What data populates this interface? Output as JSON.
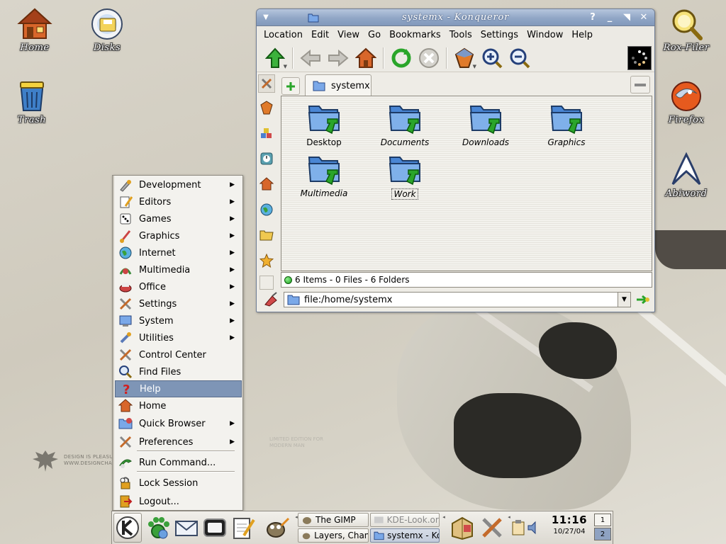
{
  "desktop": {
    "icons": [
      {
        "label": "Home"
      },
      {
        "label": "Disks"
      },
      {
        "label": "Trash"
      },
      {
        "label": "Rox-Filer"
      },
      {
        "label": "Firefox"
      },
      {
        "label": "Abiword"
      }
    ],
    "watermark": {
      "line1": "DESIGN IS PLEASURE",
      "line2": "WWW.DESIGNCHAPE..."
    },
    "watermark2": {
      "line1": "LIMITED EDITION FOR",
      "line2": "MODERN MAN"
    }
  },
  "konqueror": {
    "title": "systemx - Konqueror",
    "title_buttons": {
      "help": "?",
      "minimize": "_",
      "shade": "◥",
      "close": "✕"
    },
    "menus": [
      "Location",
      "Edit",
      "View",
      "Go",
      "Bookmarks",
      "Tools",
      "Settings",
      "Window",
      "Help"
    ],
    "tab_label": "systemx",
    "files": [
      {
        "name": "Desktop",
        "italic": false
      },
      {
        "name": "Documents",
        "italic": true
      },
      {
        "name": "Downloads",
        "italic": true
      },
      {
        "name": "Graphics",
        "italic": true
      },
      {
        "name": "Multimedia",
        "italic": true
      },
      {
        "name": "Work",
        "italic": true,
        "selected": true
      }
    ],
    "status": "6 Items - 0 Files - 6 Folders",
    "location": "file:/home/systemx"
  },
  "kmenu": {
    "items": [
      {
        "label": "Development",
        "submenu": true,
        "icon": "development-icon"
      },
      {
        "label": "Editors",
        "submenu": true,
        "icon": "editors-icon"
      },
      {
        "label": "Games",
        "submenu": true,
        "icon": "games-icon"
      },
      {
        "label": "Graphics",
        "submenu": true,
        "icon": "graphics-icon"
      },
      {
        "label": "Internet",
        "submenu": true,
        "icon": "internet-icon"
      },
      {
        "label": "Multimedia",
        "submenu": true,
        "icon": "multimedia-icon"
      },
      {
        "label": "Office",
        "submenu": true,
        "icon": "office-icon"
      },
      {
        "label": "Settings",
        "submenu": true,
        "icon": "settings-icon"
      },
      {
        "label": "System",
        "submenu": true,
        "icon": "system-icon"
      },
      {
        "label": "Utilities",
        "submenu": true,
        "icon": "utilities-icon"
      },
      {
        "label": "Control Center",
        "submenu": false,
        "icon": "control-center-icon"
      },
      {
        "label": "Find Files",
        "submenu": false,
        "icon": "find-files-icon"
      },
      {
        "label": "Help",
        "submenu": false,
        "icon": "help-icon",
        "active": true
      },
      {
        "label": "Home",
        "submenu": false,
        "icon": "home-icon"
      },
      {
        "label": "Quick Browser",
        "submenu": true,
        "icon": "quick-browser-icon"
      },
      {
        "label": "Preferences",
        "submenu": true,
        "icon": "preferences-icon"
      },
      {
        "label": "Run Command...",
        "submenu": false,
        "icon": "run-command-icon"
      },
      {
        "label": "Lock Session",
        "submenu": false,
        "icon": "lock-session-icon"
      },
      {
        "label": "Logout...",
        "submenu": false,
        "icon": "logout-icon"
      }
    ],
    "submenu_arrow": "▶"
  },
  "panel": {
    "tasks": [
      {
        "label": "The GIMP"
      },
      {
        "label": "KDE-Look.org"
      },
      {
        "label": "Layers, Chann"
      },
      {
        "label": "systemx - Ko"
      }
    ],
    "clock": {
      "time": "11:16",
      "date": "10/27/04"
    },
    "pager": [
      "1",
      "2"
    ]
  },
  "colors": {
    "titlebar": "#90a6c6",
    "menu_highlight": "#7e95b6",
    "folder_blue": "#4a86d4",
    "folder_arrow_green": "#2aa52a"
  }
}
